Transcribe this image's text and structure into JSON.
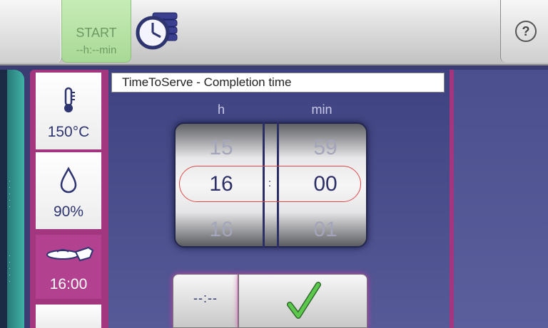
{
  "topbar": {
    "start_label": "START",
    "start_time": "--h:--min",
    "help_label": "?"
  },
  "sidebar": {
    "temperature": "150°C",
    "humidity": "90%",
    "serve_time": "16:00"
  },
  "panel": {
    "title": "TimeToServe - Completion time",
    "col_hours": "h",
    "col_minutes": "min",
    "hours_prev": "15",
    "hours_current": "16",
    "hours_next": "16",
    "minutes_prev": "59",
    "minutes_current": "00",
    "minutes_next": "01",
    "separator": ":",
    "clear_label": "--:--"
  },
  "colors": {
    "accent": "#a2367f",
    "start_green": "#a9d996",
    "check_green": "#4bb83f",
    "panel_blue": "#3e4280"
  }
}
